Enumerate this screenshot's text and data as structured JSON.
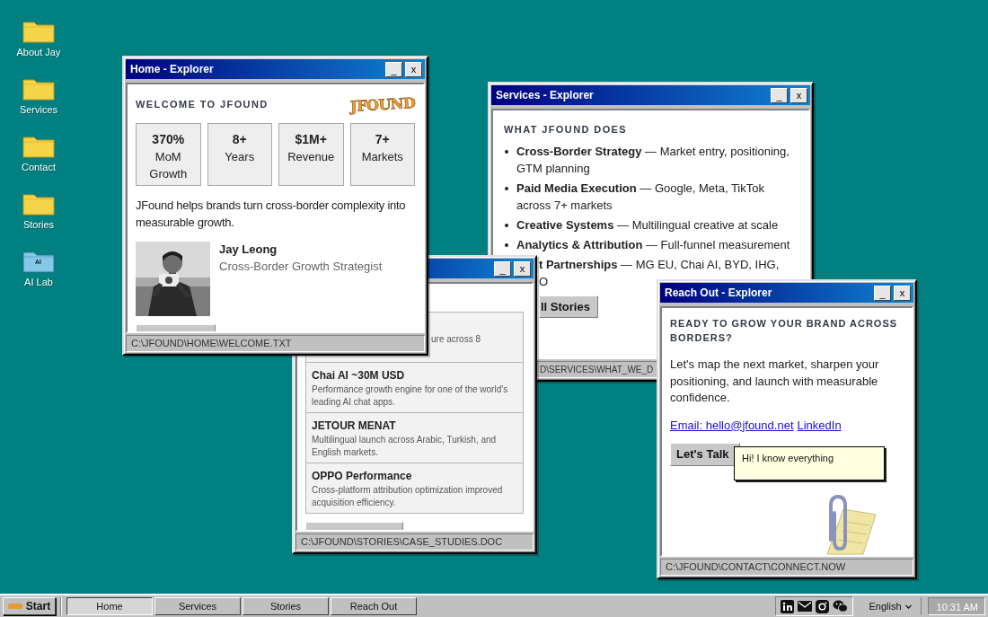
{
  "desktop_icons": [
    {
      "label": "About Jay",
      "kind": "folder"
    },
    {
      "label": "Services",
      "kind": "folder"
    },
    {
      "label": "Contact",
      "kind": "folder"
    },
    {
      "label": "Stories",
      "kind": "folder"
    },
    {
      "label": "AI Lab",
      "kind": "lab",
      "badge": "AI"
    }
  ],
  "home_window": {
    "title": "Home - Explorer",
    "minimize": "_",
    "close": "x",
    "heading": "WELCOME TO JFOUND",
    "logo": "JFOUND",
    "stats": [
      {
        "value": "370%",
        "label": "MoM Growth"
      },
      {
        "value": "8+",
        "label": "Years"
      },
      {
        "value": "$1M+",
        "label": "Revenue"
      },
      {
        "value": "7+",
        "label": "Markets"
      }
    ],
    "intro": "JFound helps brands turn cross-border complexity into measurable growth.",
    "profile": {
      "name": "Jay Leong",
      "role": "Cross-Border Growth Strategist"
    },
    "status": "C:\\JFOUND\\HOME\\WELCOME.TXT"
  },
  "stories_window": {
    "minimize": "_",
    "close": "x",
    "cases": [
      {
        "description": "ure across 8"
      },
      {
        "title": "Chai AI ~30M USD",
        "description": "Performance growth engine for one of the world's leading AI chat apps."
      },
      {
        "title": "JETOUR MENAT",
        "description": "Multilingual launch across Arabic, Turkish, and English markets."
      },
      {
        "title": "OPPO Performance",
        "description": "Cross-platform attribution optimization improved acquisition efficiency."
      }
    ],
    "status": "C:\\JFOUND\\STORIES\\CASE_STUDIES.DOC"
  },
  "services_window": {
    "title": "Services - Explorer",
    "minimize": "_",
    "close": "x",
    "heading": "WHAT JFOUND DOES",
    "services": [
      {
        "kind": "bullet",
        "text": "**Cross-Border Strategy** — Market entry, positioning, GTM planning"
      },
      {
        "kind": "bullet",
        "text": "**Paid Media Execution** — Google, Meta, TikTok across 7+ markets"
      },
      {
        "kind": "bullet",
        "text": "**Creative Systems** — Multilingual creative at scale"
      },
      {
        "kind": "bullet",
        "text": "**Analytics & Attribution** — Full-funnel measurement"
      },
      {
        "kind": "clipped",
        "text": "**t Partnerships** — MG EU, Chai AI, BYD, IHG,\nO"
      }
    ],
    "button": "ll Stories",
    "status": "D\\SERVICES\\WHAT_WE_D"
  },
  "reach_out_window": {
    "title": "Reach Out - Explorer",
    "minimize": "_",
    "close": "x",
    "heading": "READY TO GROW YOUR BRAND ACROSS BORDERS?",
    "body": "Let's map the next market, sharpen your positioning, and launch with measurable confidence.",
    "links": [
      "Email: hello@jfound.net",
      "LinkedIn"
    ],
    "button": "Let's Talk",
    "assistant_bubble": "Hi! I know everything",
    "status": "C:\\JFOUND\\CONTACT\\CONNECT.NOW"
  },
  "taskbar": {
    "start": "Start",
    "tasks": [
      {
        "label": "Home",
        "selected": true
      },
      {
        "label": "Services",
        "selected": false
      },
      {
        "label": "Stories",
        "selected": false
      },
      {
        "label": "Reach Out",
        "selected": false
      }
    ],
    "language": "English",
    "clock": "10:31 AM"
  }
}
